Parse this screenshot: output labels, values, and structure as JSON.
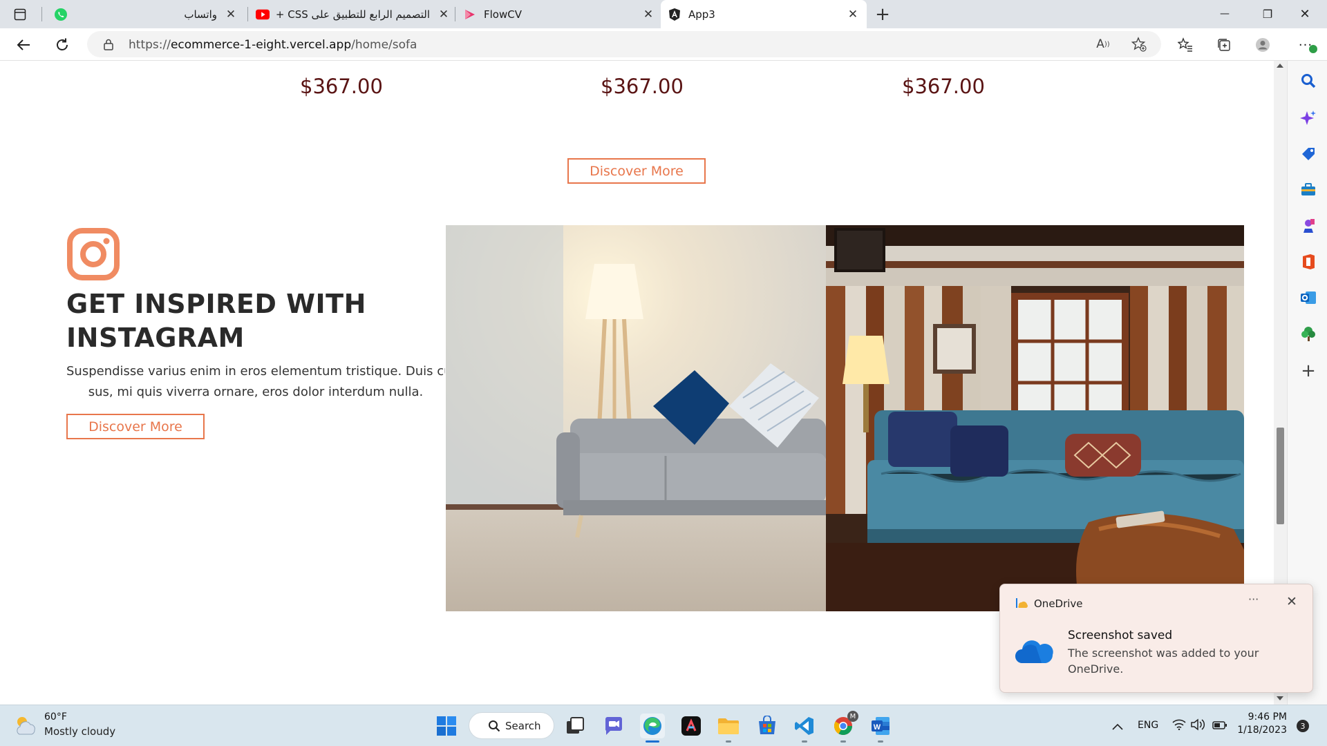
{
  "browser": {
    "tabs": [
      {
        "title": "واتساب",
        "icon": "whatsapp-icon"
      },
      {
        "title": "التصميم الرابع للتطبيق على CSS +",
        "icon": "youtube-icon"
      },
      {
        "title": "FlowCV",
        "icon": "flowcv-icon"
      },
      {
        "title": "App3",
        "icon": "angular-icon",
        "active": true
      }
    ],
    "new_tab_symbol": "+",
    "window_controls": {
      "minimize": "—",
      "restore": "❐",
      "close": "✕"
    },
    "address": {
      "prefix": "https://",
      "host": "ecommerce-1-eight.vercel.app",
      "path": "/home/sofa"
    }
  },
  "page": {
    "prices": [
      "$367.00",
      "$367.00",
      "$367.00"
    ],
    "discover_more_top": "Discover More",
    "instagram": {
      "title_line1": "GET INSPIRED WITH",
      "title_line2": "INSTAGRAM",
      "desc_line1": "Suspendisse varius enim in eros elementum tristique. Duis cur",
      "desc_line2": "sus, mi quis viverra ornare, eros dolor interdum nulla.",
      "button": "Discover More"
    },
    "accent_color": "#e8764b"
  },
  "toast": {
    "app": "OneDrive",
    "more": "···",
    "close": "✕",
    "heading": "Screenshot saved",
    "body": "The screenshot was added to your OneDrive."
  },
  "taskbar": {
    "weather_temp": "60°F",
    "weather_cond": "Mostly cloudy",
    "search_label": "Search",
    "language": "ENG",
    "time": "9:46 PM",
    "date": "1/18/2023",
    "notification_count": "3",
    "chrome_badge": "M"
  }
}
